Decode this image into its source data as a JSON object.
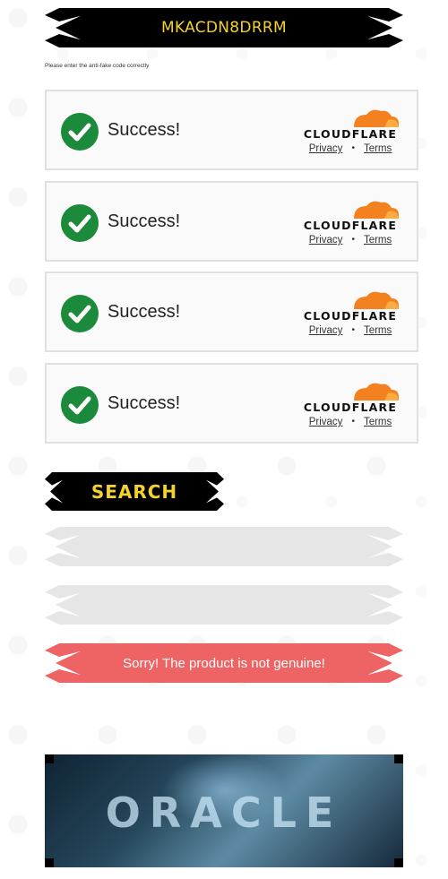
{
  "code_banner": {
    "code": "MKACDN8DRRM"
  },
  "instruction": "Please enter the anti-fake code correctly",
  "widgets": [
    {
      "status": "Success!",
      "brand": "CLOUDFLARE",
      "privacy": "Privacy",
      "separator": "•",
      "terms": "Terms"
    },
    {
      "status": "Success!",
      "brand": "CLOUDFLARE",
      "privacy": "Privacy",
      "separator": "•",
      "terms": "Terms"
    },
    {
      "status": "Success!",
      "brand": "CLOUDFLARE",
      "privacy": "Privacy",
      "separator": "•",
      "terms": "Terms"
    },
    {
      "status": "Success!",
      "brand": "CLOUDFLARE",
      "privacy": "Privacy",
      "separator": "•",
      "terms": "Terms"
    }
  ],
  "search_banner": {
    "label": "SEARCH"
  },
  "result": {
    "message": "Sorry! The product is not genuine!"
  },
  "footer_banner": {
    "logo_text": "ORACLE"
  },
  "colors": {
    "banner_bg": "#000000",
    "banner_text": "#f2d22e",
    "success_green": "#1b8a3a",
    "cloudflare_orange": "#f48120",
    "error_red": "#ee6363",
    "input_gray": "#e6e6e6"
  },
  "icons": [
    "checkmark-icon",
    "cloudflare-cloud-icon"
  ]
}
